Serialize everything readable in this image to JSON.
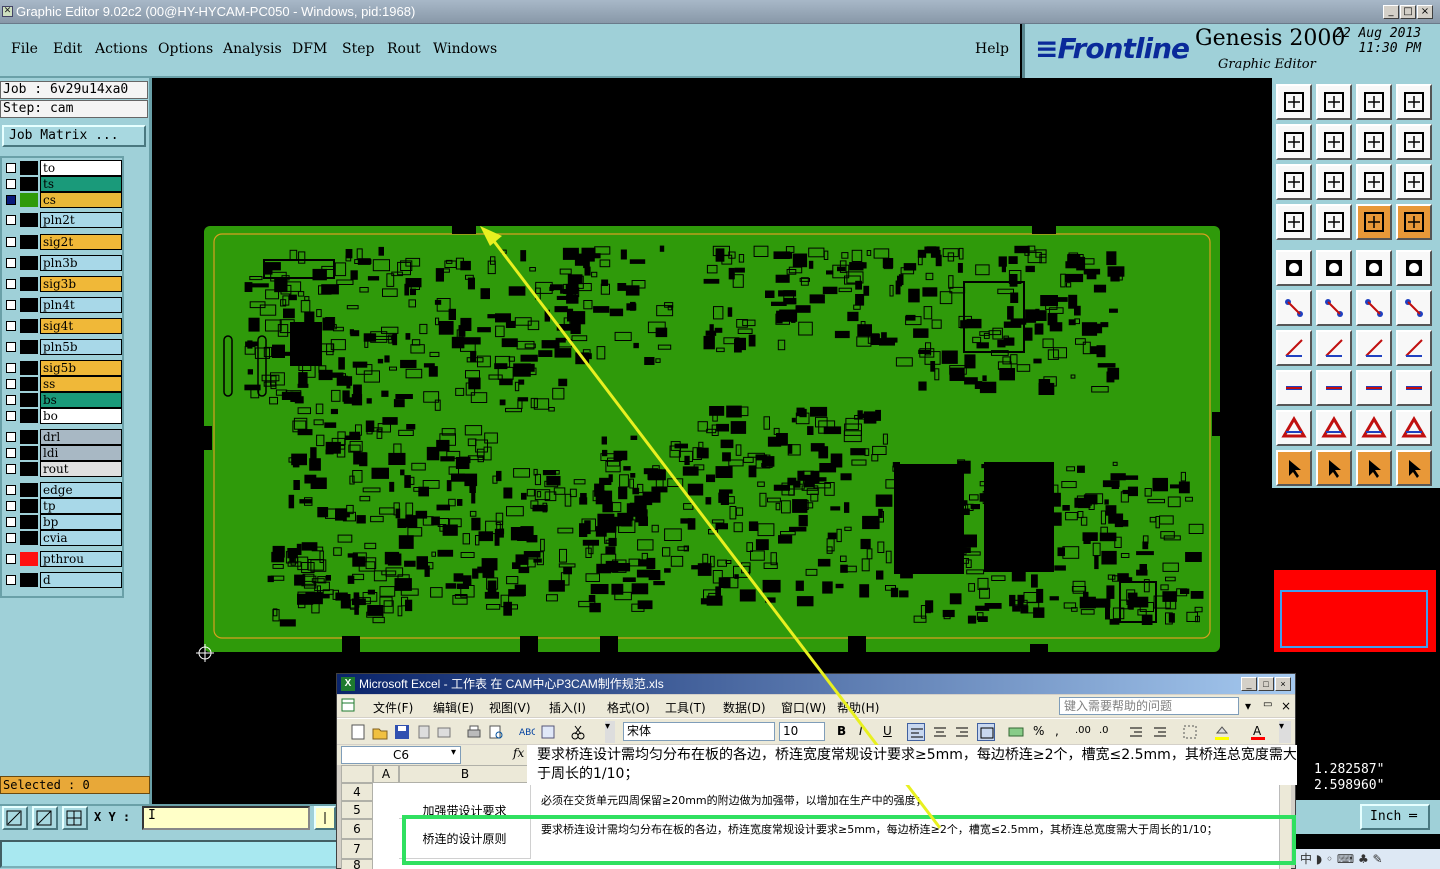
{
  "window": {
    "title": "Graphic Editor 9.02c2 (00@HY-HYCAM-PC050 - Windows, pid:1968)",
    "min": "_",
    "max": "□",
    "close": "×"
  },
  "menu": {
    "items": [
      "File",
      "Edit",
      "Actions",
      "Options",
      "Analysis",
      "DFM",
      "Step",
      "Rout",
      "Windows"
    ],
    "help": "Help"
  },
  "brand": {
    "logo": "≡Frontline",
    "product": "Genesis 2000",
    "subtitle": "Graphic Editor",
    "date": "22 Aug 2013",
    "time": "11:30 PM"
  },
  "job": {
    "job_line": "Job : 6v29u14xa0",
    "step_line": "Step: cam",
    "matrix_button": "Job Matrix ..."
  },
  "layers": [
    {
      "name": "to",
      "color": "#ffffff",
      "on": false
    },
    {
      "name": "ts",
      "color": "#1a9a7a",
      "on": false
    },
    {
      "name": "cs",
      "color": "#e8b838",
      "on": true
    },
    {
      "name": "pln2t",
      "color": "#a8d8e8",
      "on": false
    },
    {
      "name": "sig2t",
      "color": "#f0b838",
      "on": false
    },
    {
      "name": "pln3b",
      "color": "#a8d8e8",
      "on": false
    },
    {
      "name": "sig3b",
      "color": "#f0b838",
      "on": false
    },
    {
      "name": "pln4t",
      "color": "#a8d8e8",
      "on": false
    },
    {
      "name": "sig4t",
      "color": "#f0b838",
      "on": false
    },
    {
      "name": "pln5b",
      "color": "#a8d8e8",
      "on": false
    },
    {
      "name": "sig5b",
      "color": "#f0b838",
      "on": false
    },
    {
      "name": "ss",
      "color": "#f0b838",
      "on": false
    },
    {
      "name": "bs",
      "color": "#1a9a7a",
      "on": false
    },
    {
      "name": "bo",
      "color": "#ffffff",
      "on": false
    },
    {
      "name": "drl",
      "color": "#a8b8c4",
      "on": false
    },
    {
      "name": "ldi",
      "color": "#a8b8c4",
      "on": false
    },
    {
      "name": "rout",
      "color": "#e0e0e0",
      "on": false
    },
    {
      "name": "edge",
      "color": "#a8d8e8",
      "on": false
    },
    {
      "name": "tp",
      "color": "#a8d8e8",
      "on": false
    },
    {
      "name": "bp",
      "color": "#a8d8e8",
      "on": false
    },
    {
      "name": "cvia",
      "color": "#a8d8e8",
      "on": false
    },
    {
      "name": "pthrou",
      "color": "#a8d8e8",
      "on": false
    },
    {
      "name": "d",
      "color": "#a8d8e8",
      "on": false
    }
  ],
  "status": {
    "selected": "Selected : 0",
    "xy_label": "X Y :",
    "xy_value": "I"
  },
  "coords": {
    "x": "1.282587\"",
    "y": "2.598960\"",
    "units": "Inch"
  },
  "ime": "中 ◗ ◦ ⌨ ♣ ✎",
  "excel": {
    "title": "Microsoft Excel - 工作表 在 CAM中心P3CAM制作规范.xls",
    "menu": [
      "文件(F)",
      "编辑(E)",
      "视图(V)",
      "插入(I)",
      "格式(O)",
      "工具(T)",
      "数据(D)",
      "窗口(W)",
      "帮助(H)"
    ],
    "help_placeholder": "键入需要帮助的问题",
    "font_name": "宋体",
    "font_size": "10",
    "namebox": "C6",
    "fx": "fx",
    "formula_text": "要求桥连设计需均匀分布在板的各边，桥连宽度常规设计要求≥5mm，每边桥连≥2个，槽宽≤2.5mm，其桥连总宽度需大于周长的1/10；",
    "col_a": "A",
    "col_b": "B",
    "rows": [
      {
        "num": "4",
        "b": "",
        "c": ""
      },
      {
        "num": "5",
        "b": "加强带设计要求",
        "c": "必须在交货单元四周保留≥20mm的附边做为加强带，以增加在生产中的强度；"
      },
      {
        "num": "6",
        "b": "桥连的设计原则",
        "c": "要求桥连设计需均匀分布在板的各边，桥连宽度常规设计要求≥5mm，每边桥连≥2个，槽宽≤2.5mm，其桥连总宽度需大于周长的1/10；"
      },
      {
        "num": "7",
        "b": "",
        "c": ""
      },
      {
        "num": "8",
        "b": "",
        "c": ""
      }
    ],
    "colors": {
      "highlight": "#30e060",
      "arrow": "#e8f020"
    }
  },
  "board": {
    "fill": "#2f9a0a",
    "outline": "#d8a020"
  }
}
